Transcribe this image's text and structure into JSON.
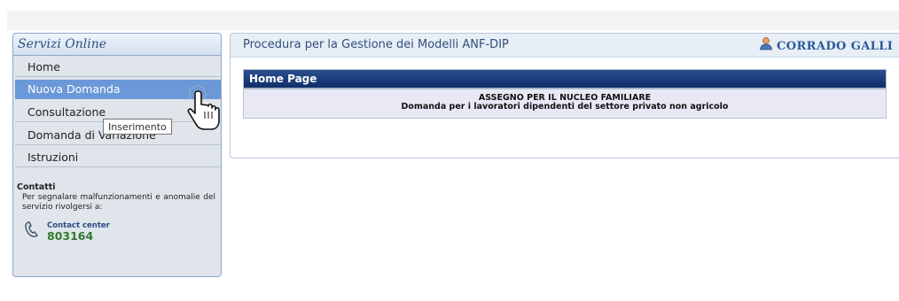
{
  "sidebar": {
    "title": "Servizi Online",
    "items": [
      {
        "label": "Home"
      },
      {
        "label": "Nuova Domanda"
      },
      {
        "label": "Consultazione"
      },
      {
        "label": "Domanda di Variazione"
      },
      {
        "label": "Istruzioni"
      }
    ],
    "contacts": {
      "title": "Contatti",
      "text": "Per segnalare malfunzionamenti e anomalie del servizio rivolgersi a:",
      "center_label": "Contact center",
      "number": "803164",
      "icon": "phone-icon"
    }
  },
  "tooltip": "Inserimento",
  "header": {
    "procedure_title": "Procedura per la Gestione dei Modelli ANF-DIP",
    "user_name": "CORRADO GALLI",
    "user_icon": "user-icon"
  },
  "panel": {
    "title": "Home Page",
    "line1": "ASSEGNO PER IL NUCLEO FAMILIARE",
    "line2": "Domanda per i lavoratori dipendenti del settore privato non agricolo"
  },
  "colors": {
    "active_menu": "#6b98d8",
    "panel_header": "#1f3f7a",
    "sidebar_bg": "#dfe5ea",
    "contact_number": "#2f7a2f"
  }
}
